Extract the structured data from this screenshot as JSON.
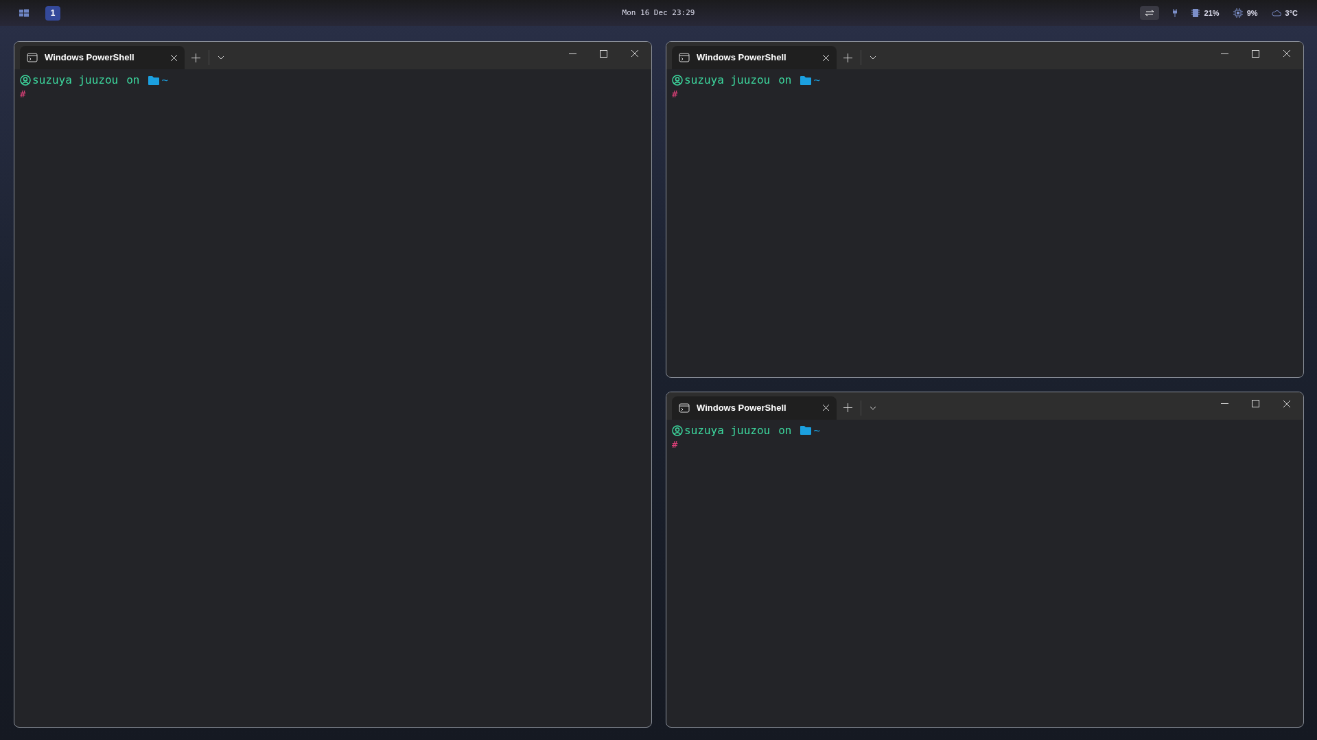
{
  "top_bar": {
    "workspaces": [
      {
        "label": "1",
        "selected": true
      }
    ],
    "clock": "Mon 16 Dec 23:29",
    "stats": [
      {
        "kind": "memory",
        "value": "21%"
      },
      {
        "kind": "cpu",
        "value": "9%"
      },
      {
        "kind": "weather",
        "value": "3°C"
      }
    ]
  },
  "windows": [
    {
      "tab_title": "Windows PowerShell",
      "prompt": {
        "user": "suzuya juuzou",
        "word": "on",
        "path": "~",
        "symbol": "#"
      }
    },
    {
      "tab_title": "Windows PowerShell",
      "prompt": {
        "user": "suzuya juuzou",
        "word": "on",
        "path": "~",
        "symbol": "#"
      }
    },
    {
      "tab_title": "Windows PowerShell",
      "prompt": {
        "user": "suzuya juuzou",
        "word": "on",
        "path": "~",
        "symbol": "#"
      }
    }
  ]
}
